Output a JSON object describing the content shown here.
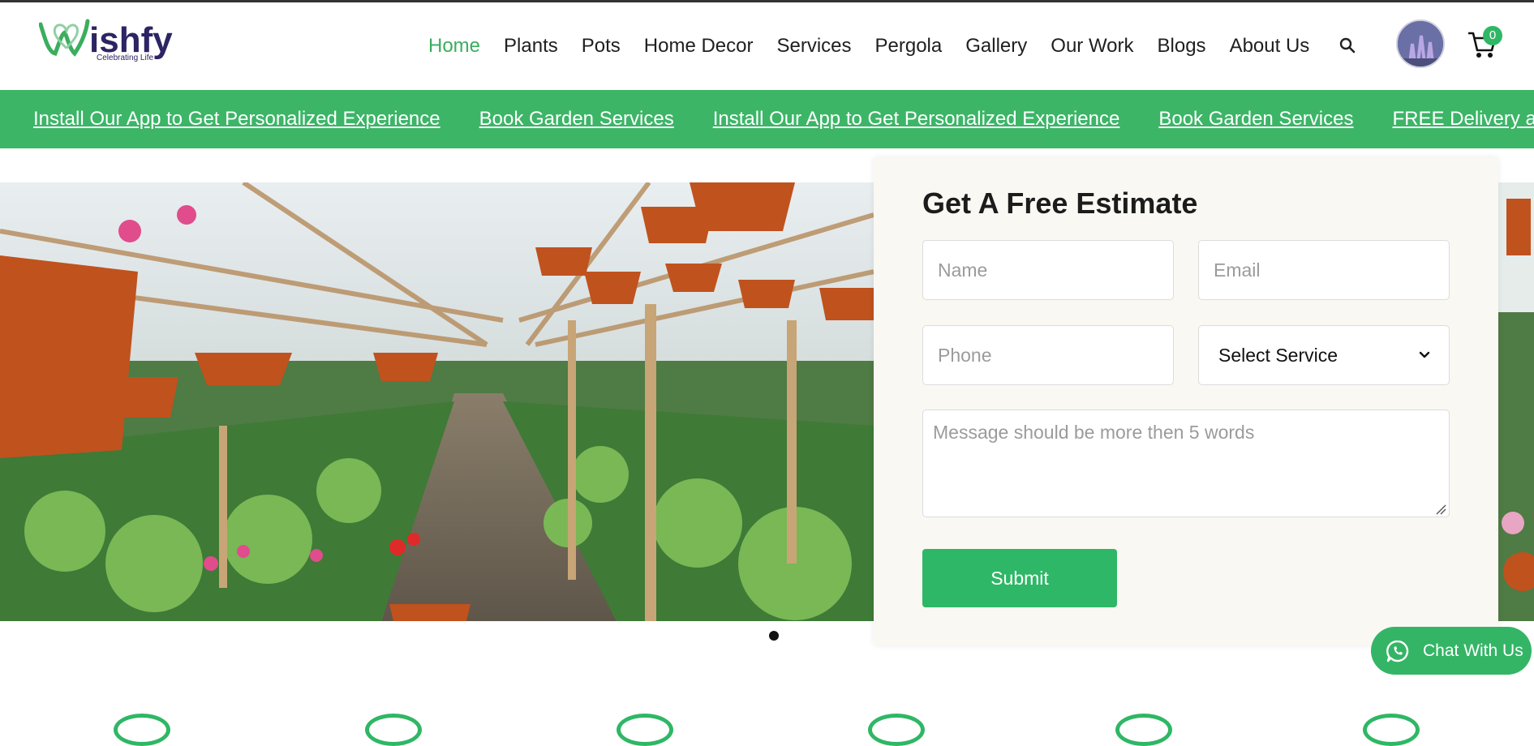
{
  "brand": {
    "name": "Wishfy",
    "tagline": "Celebrating Life",
    "accent": "#3aae5e",
    "navy": "#2c2463"
  },
  "nav": {
    "items": [
      {
        "label": "Home",
        "active": true
      },
      {
        "label": "Plants"
      },
      {
        "label": "Pots"
      },
      {
        "label": "Home Decor"
      },
      {
        "label": "Services"
      },
      {
        "label": "Pergola"
      },
      {
        "label": "Gallery"
      },
      {
        "label": "Our Work"
      },
      {
        "label": "Blogs"
      },
      {
        "label": "About Us"
      }
    ],
    "search_icon": "search-icon",
    "cart_count": "0"
  },
  "marquee": {
    "items": [
      "Install Our App to Get Personalized Experience",
      "Book Garden Services",
      "Install Our App to Get Personalized Experience",
      "Book Garden Services",
      "FREE Delivery above"
    ],
    "bg_color": "#3cb567"
  },
  "estimate_form": {
    "title": "Get A Free Estimate",
    "name_placeholder": "Name",
    "email_placeholder": "Email",
    "phone_placeholder": "Phone",
    "service_selected": "Select Service",
    "message_placeholder": "Message should be more then 5 words",
    "submit_label": "Submit"
  },
  "chat": {
    "label": "Chat With Us",
    "icon": "whatsapp-icon"
  }
}
